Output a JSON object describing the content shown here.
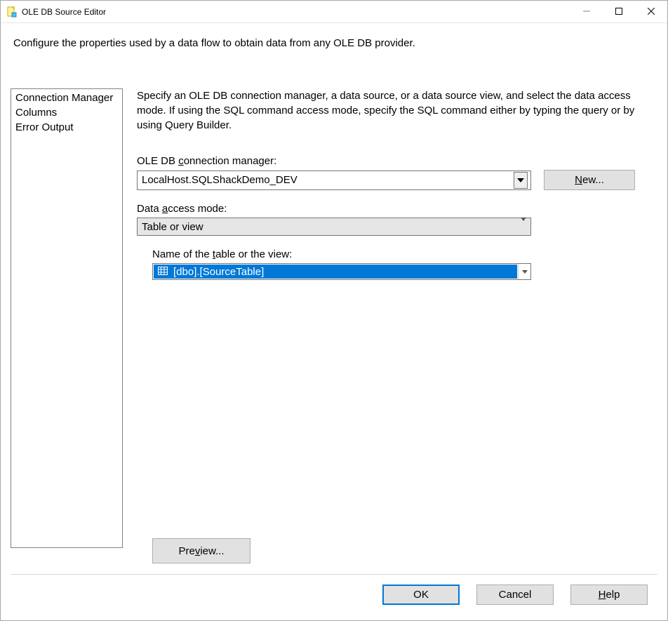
{
  "window": {
    "title": "OLE DB Source Editor"
  },
  "intro": "Configure the properties used by a data flow to obtain data from any OLE DB provider.",
  "sidebar": {
    "items": [
      {
        "label": "Connection Manager",
        "selected": true
      },
      {
        "label": "Columns"
      },
      {
        "label": "Error Output"
      }
    ]
  },
  "pane": {
    "description": "Specify an OLE DB connection manager, a data source, or a data source view, and select the data access mode. If using the SQL command access mode, specify the SQL command either by typing the query or by using Query Builder.",
    "conn_label_pre": "OLE DB ",
    "conn_label_ul": "c",
    "conn_label_post": "onnection manager:",
    "conn_value": "LocalHost.SQLShackDemo_DEV",
    "new_btn_pre": "",
    "new_btn_ul": "N",
    "new_btn_post": "ew...",
    "access_label_pre": "Data ",
    "access_label_ul": "a",
    "access_label_post": "ccess mode:",
    "access_value": "Table or view",
    "table_label_pre": "Name of the ",
    "table_label_ul": "t",
    "table_label_post": "able or the view:",
    "table_value": "[dbo].[SourceTable]",
    "preview_pre": "Pre",
    "preview_ul": "v",
    "preview_post": "iew..."
  },
  "footer": {
    "ok": "OK",
    "cancel": "Cancel",
    "help_ul": "H",
    "help_post": "elp"
  }
}
